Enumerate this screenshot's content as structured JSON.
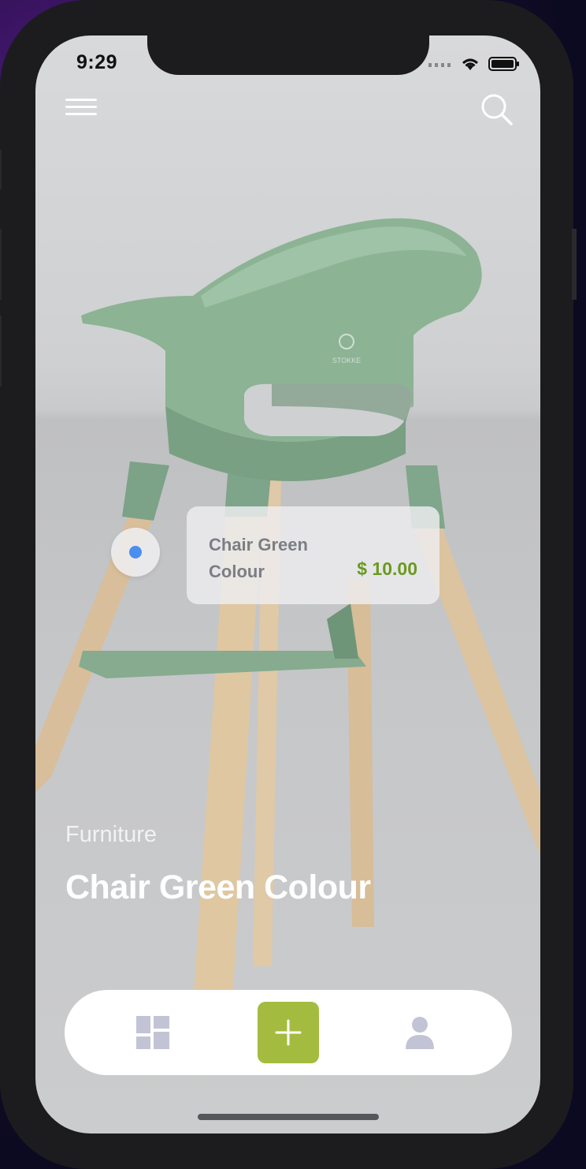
{
  "status_bar": {
    "time": "9:29"
  },
  "header": {
    "menu_icon": "menu-icon",
    "search_icon": "search-icon"
  },
  "product_tag": {
    "name": "Chair Green Colour",
    "price": "$ 10.00"
  },
  "product": {
    "category": "Furniture",
    "title": "Chair Green Colour"
  },
  "bottom_nav": {
    "items": [
      {
        "icon": "dashboard-icon"
      },
      {
        "icon": "plus-icon",
        "active": true
      },
      {
        "icon": "profile-icon"
      }
    ]
  },
  "colors": {
    "accent": "#a3bc3f",
    "price": "#6a9a1e",
    "hotspot_dot": "#4a8ff0",
    "nav_icon": "#c2c4d6"
  }
}
